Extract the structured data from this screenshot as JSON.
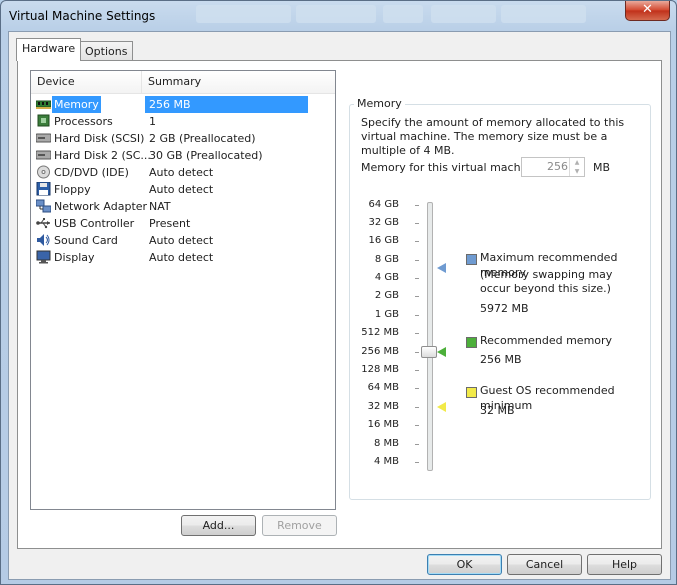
{
  "window": {
    "title": "Virtual Machine Settings",
    "close_glyph": "✕"
  },
  "tabs": [
    {
      "label": "Hardware"
    },
    {
      "label": "Options"
    }
  ],
  "device_list": {
    "headers": {
      "device": "Device",
      "summary": "Summary"
    },
    "rows": [
      {
        "name": "Memory",
        "summary": "256 MB",
        "icon": "memory-icon",
        "selected": true
      },
      {
        "name": "Processors",
        "summary": "1",
        "icon": "processor-icon"
      },
      {
        "name": "Hard Disk (SCSI)",
        "summary": "2 GB (Preallocated)",
        "icon": "hard-disk-icon"
      },
      {
        "name": "Hard Disk 2 (SC...",
        "summary": "30 GB (Preallocated)",
        "icon": "hard-disk-icon"
      },
      {
        "name": "CD/DVD (IDE)",
        "summary": "Auto detect",
        "icon": "cd-dvd-icon"
      },
      {
        "name": "Floppy",
        "summary": "Auto detect",
        "icon": "floppy-icon"
      },
      {
        "name": "Network Adapter",
        "summary": "NAT",
        "icon": "network-adapter-icon"
      },
      {
        "name": "USB Controller",
        "summary": "Present",
        "icon": "usb-icon"
      },
      {
        "name": "Sound Card",
        "summary": "Auto detect",
        "icon": "sound-card-icon"
      },
      {
        "name": "Display",
        "summary": "Auto detect",
        "icon": "display-icon"
      }
    ]
  },
  "buttons": {
    "add": "Add...",
    "remove": "Remove",
    "ok": "OK",
    "cancel": "Cancel",
    "help": "Help"
  },
  "memory": {
    "group_label": "Memory",
    "description": "Specify the amount of memory allocated to this virtual machine. The memory size must be a multiple of 4 MB.",
    "field_label": "Memory for this virtual machine:",
    "value": "256",
    "unit": "MB",
    "scale": [
      "64 GB",
      "32 GB",
      "16 GB",
      "8 GB",
      "4 GB",
      "2 GB",
      "1 GB",
      "512 MB",
      "256 MB",
      "128 MB",
      "64 MB",
      "32 MB",
      "16 MB",
      "8 MB",
      "4 MB"
    ],
    "legend": {
      "max_title": "Maximum recommended memory",
      "max_note": "(Memory swapping may occur beyond this size.)",
      "max_value": "5972 MB",
      "rec_title": "Recommended memory",
      "rec_value": "256 MB",
      "min_title": "Guest OS recommended minimum",
      "min_value": "32 MB"
    },
    "colors": {
      "max": "#6f9bd1",
      "recommended": "#4caf3a",
      "minimum": "#f2ea49",
      "selection": "#3399ff"
    }
  }
}
